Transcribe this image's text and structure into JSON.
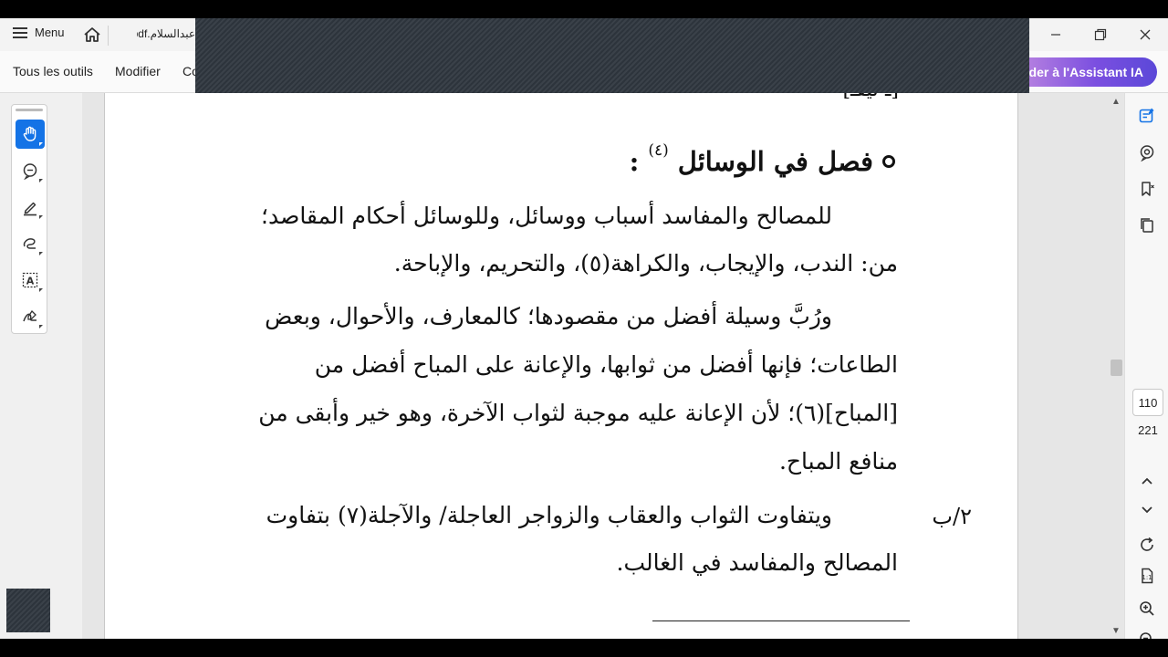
{
  "titlebar": {
    "menu_label": "Menu",
    "document_tab": "عبدالسلام.pdf",
    "icons": [
      "menu-icon",
      "home-icon",
      "minimize-icon",
      "restore-icon",
      "close-icon"
    ]
  },
  "toolbar": {
    "all_tools": "Tous les outils",
    "edit": "Modifier",
    "third": "Co",
    "ai_assistant": "der à l'Assistant IA"
  },
  "left_tools": [
    "hand-tool-icon",
    "comment-tool-icon",
    "highlight-tool-icon",
    "draw-tool-icon",
    "text-select-tool-icon",
    "sign-tool-icon"
  ],
  "document": {
    "top_fragment": "[ـ ليقـ]",
    "heading": "فصل في الوسائل",
    "heading_note": "(٤)",
    "heading_colon": ":",
    "paragraphs": [
      "للمصالح والمفاسد أسباب ووسائل، وللوسائل أحكام المقاصد؛",
      "من: الندب، والإيجاب، والكراهة(٥)، والتحريم، والإباحة.",
      "ورُبَّ وسيلة أفضل من مقصودها؛ كالمعارف، والأحوال، وبعض",
      "الطاعات؛ فإنها أفضل من ثوابها، والإعانة على المباح أفضل من",
      "[المباح](٦)؛ لأن الإعانة عليه موجبة لثواب الآخرة، وهو خير وأبقى من",
      "منافع المباح.",
      "ويتفاوت الثواب والعقاب والزواجر العاجلة/ والآجلة(٧) بتفاوت",
      "المصالح والمفاسد في الغالب."
    ],
    "margin_ref": "٢/ب"
  },
  "navigation": {
    "current_page": "110",
    "total_pages": "221"
  },
  "right_panel": [
    "edit-text-icon",
    "comment-panel-icon",
    "bookmark-icon",
    "pages-icon",
    "chevron-up-icon",
    "chevron-down-icon",
    "refresh-icon",
    "page-fit-icon",
    "zoom-in-icon",
    "zoom-out-icon"
  ],
  "colors": {
    "accent": "#1473e6",
    "overlay": "#2d343c",
    "ai_gradient_start": "#c78fe0",
    "ai_gradient_end": "#5b48d8"
  }
}
